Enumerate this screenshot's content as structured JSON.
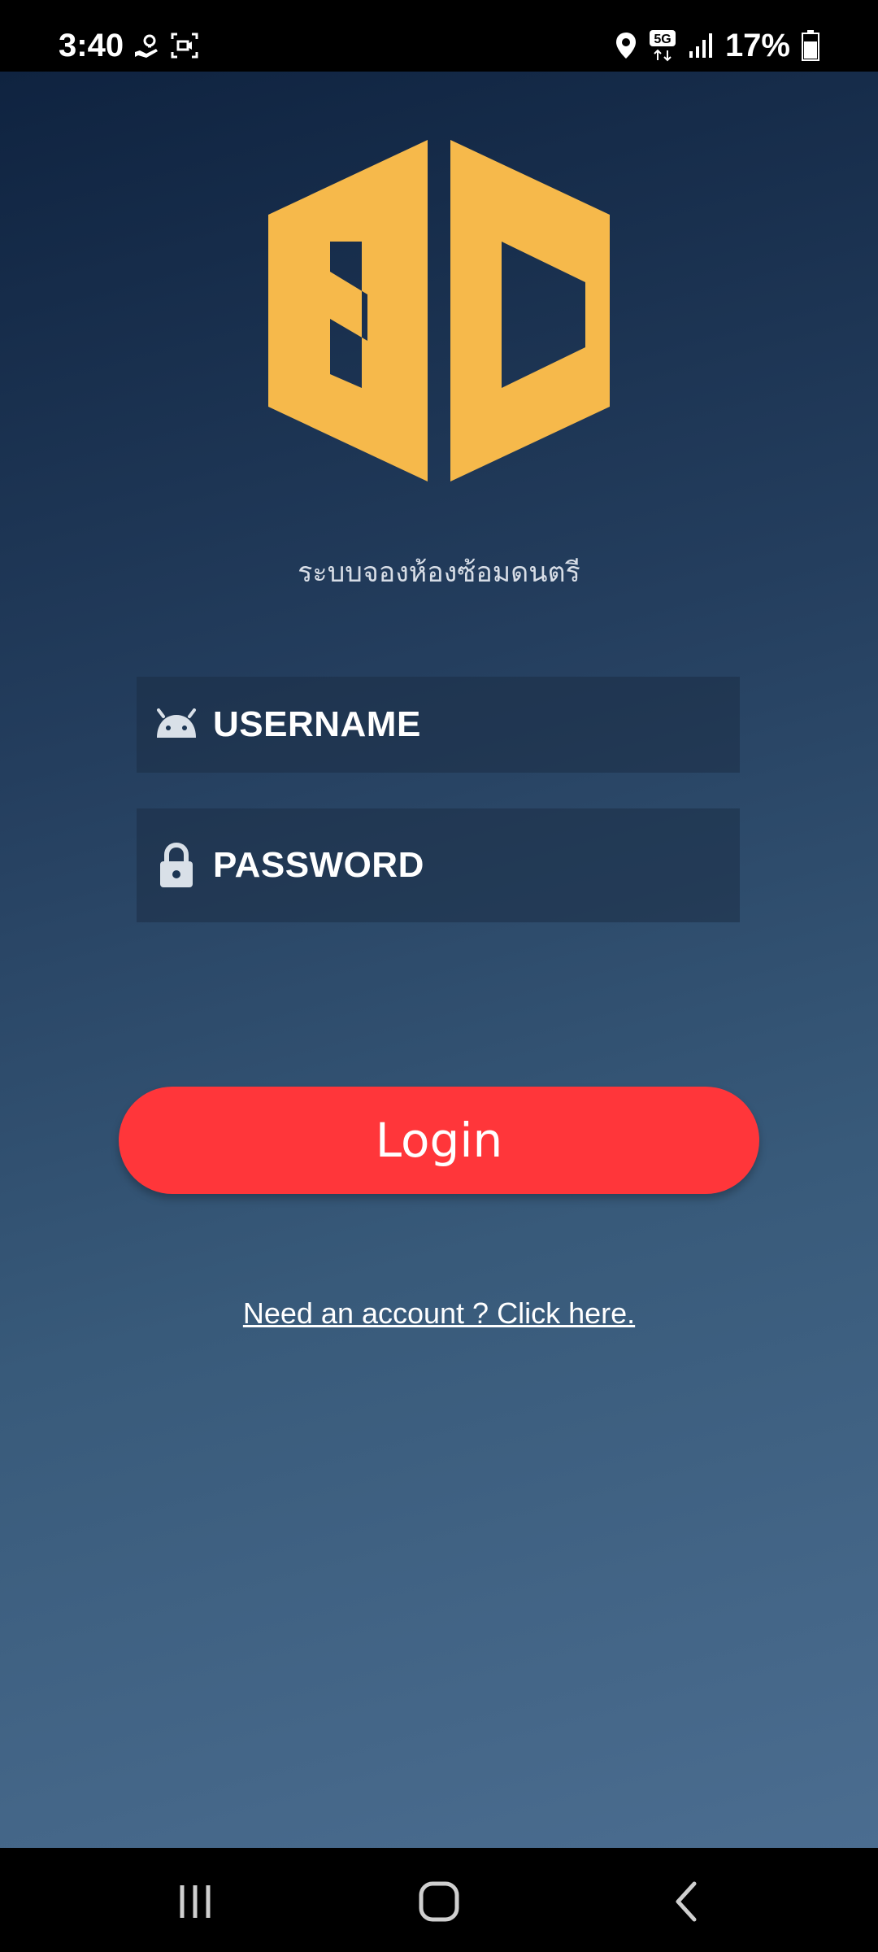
{
  "status_bar": {
    "time": "3:40",
    "battery": "17%",
    "icons": [
      "hand-money-icon",
      "screen-record-icon",
      "location-icon",
      "5g-icon",
      "signal-icon",
      "battery-icon"
    ]
  },
  "app": {
    "logo_alt": "SC",
    "subtitle": "ระบบจองห้องซ้อมดนตรี",
    "username_placeholder": "USERNAME",
    "password_placeholder": "PASSWORD",
    "login_label": "Login",
    "signup_link": "Need an account ? Click here."
  },
  "colors": {
    "brand_yellow": "#f6b94b",
    "login_red": "#ff363a",
    "bg_top": "#0f2340",
    "bg_bottom": "#4b6d90"
  },
  "nav_bar": {
    "buttons": [
      "recent-apps-icon",
      "home-icon",
      "back-icon"
    ]
  }
}
